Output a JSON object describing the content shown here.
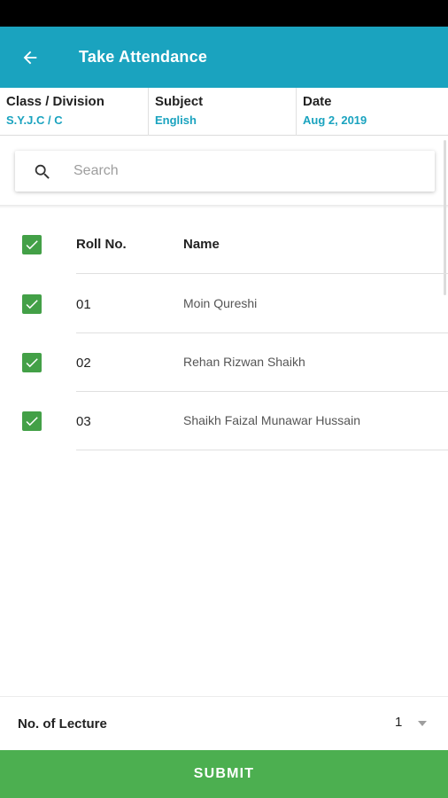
{
  "app_bar": {
    "title": "Take Attendance",
    "back_icon": "arrow-left-icon"
  },
  "info": {
    "class_label": "Class / Division",
    "class_value": "S.Y.J.C / C",
    "subject_label": "Subject",
    "subject_value": "English",
    "date_label": "Date",
    "date_value": "Aug 2, 2019"
  },
  "search": {
    "placeholder": "Search",
    "value": ""
  },
  "table": {
    "headers": {
      "roll": "Roll No.",
      "name": "Name"
    },
    "rows": [
      {
        "roll": "01",
        "name": "Moin Qureshi",
        "checked": true
      },
      {
        "roll": "02",
        "name": "Rehan Rizwan Shaikh",
        "checked": true
      },
      {
        "roll": "03",
        "name": "Shaikh Faizal Munawar Hussain",
        "checked": true
      }
    ]
  },
  "lecture": {
    "label": "No. of Lecture",
    "value": "1"
  },
  "submit": {
    "label": "SUBMIT"
  },
  "colors": {
    "primary": "#1aa3bf",
    "check": "#43a047",
    "submit": "#4caf50"
  }
}
